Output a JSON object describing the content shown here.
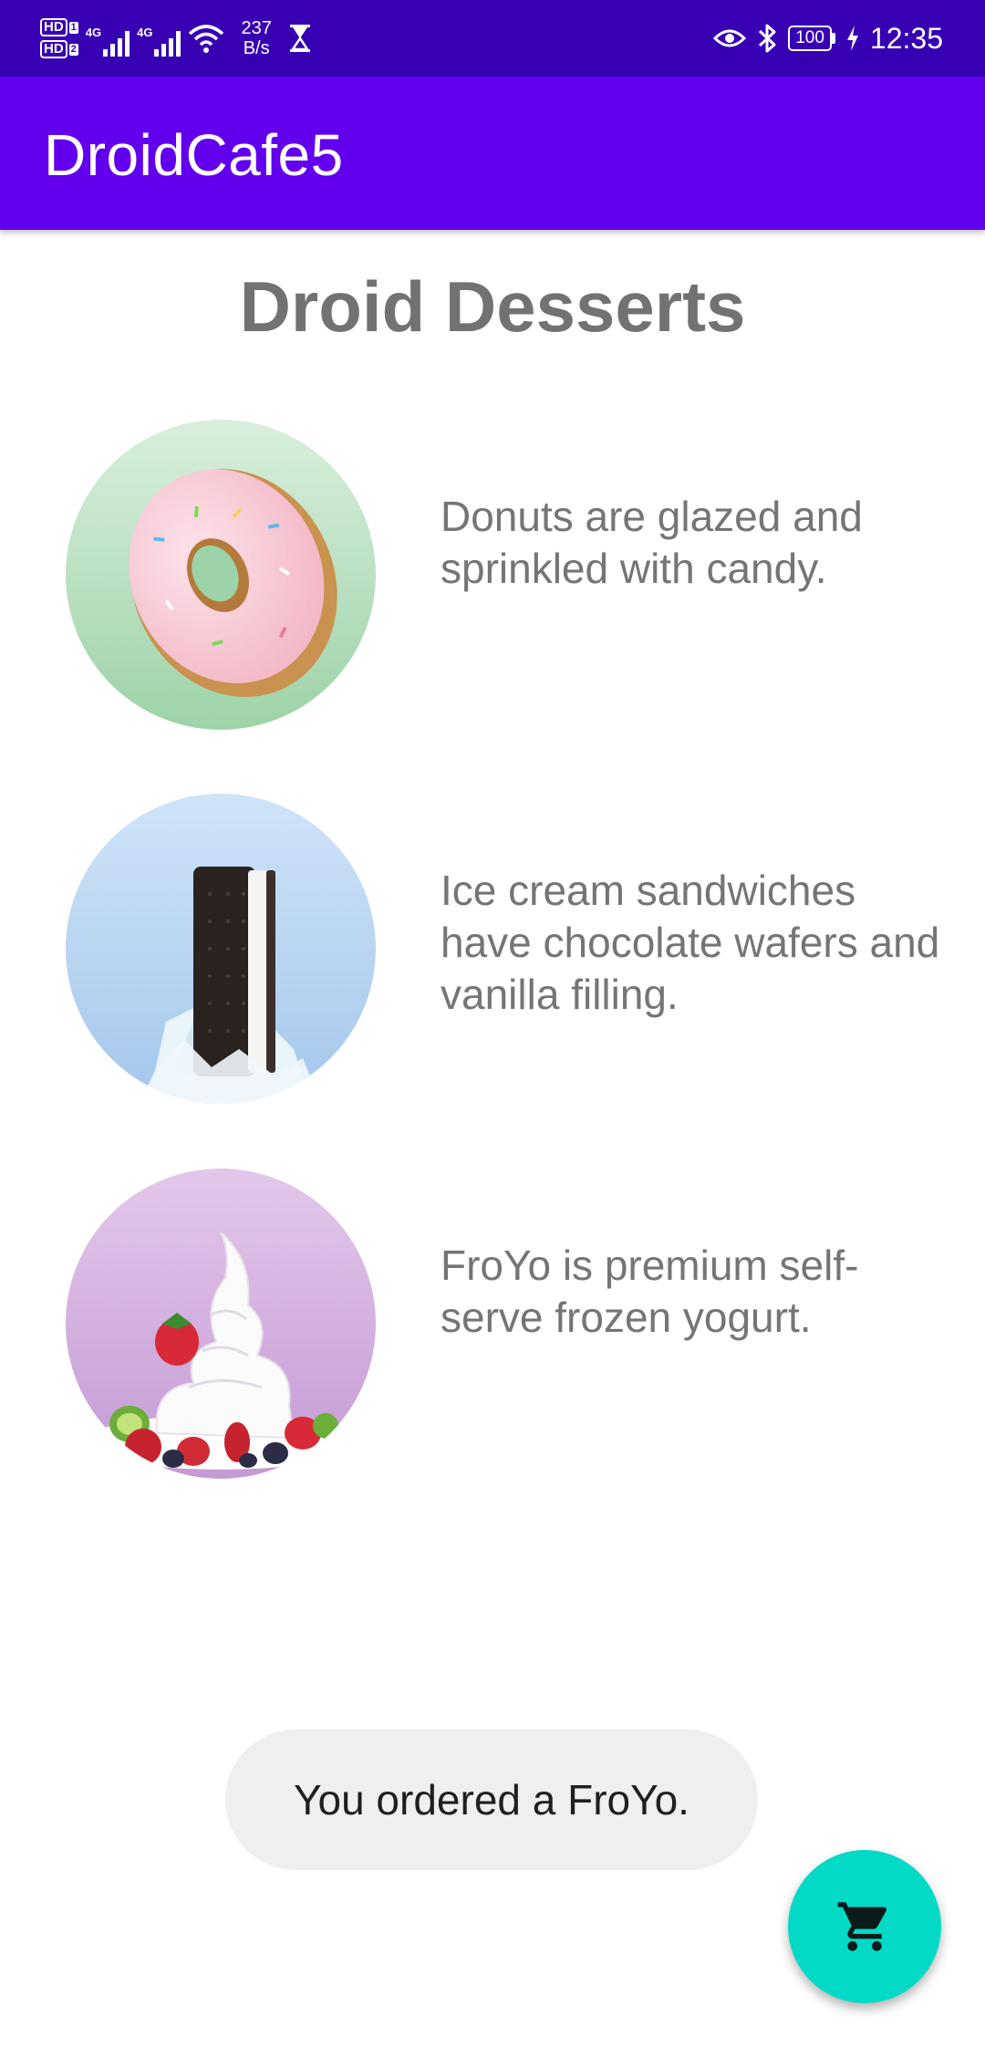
{
  "status_bar": {
    "hd1": "HD",
    "hd1_sub": "1",
    "hd2": "HD",
    "hd2_sub": "2",
    "net1": "4G",
    "net2": "4G",
    "speed_value": "237",
    "speed_unit": "B/s",
    "battery": "100",
    "time": "12:35"
  },
  "app_bar": {
    "title": "DroidCafe5"
  },
  "page": {
    "title": "Droid Desserts"
  },
  "desserts": [
    {
      "icon": "donut-image",
      "description": "Donuts are glazed and sprinkled with candy."
    },
    {
      "icon": "ice-cream-sandwich-image",
      "description": "Ice cream sandwiches have chocolate wafers and vanilla filling."
    },
    {
      "icon": "froyo-image",
      "description": "FroYo is premium self-serve frozen yogurt."
    }
  ],
  "toast": {
    "message": "You ordered a FroYo."
  },
  "fab": {
    "icon": "shopping-cart-icon"
  },
  "colors": {
    "status_bar": "#3700b3",
    "app_bar": "#6200ee",
    "fab": "#03dac5",
    "title_text": "#727272",
    "body_text": "#757575",
    "toast_bg": "#efefef"
  }
}
